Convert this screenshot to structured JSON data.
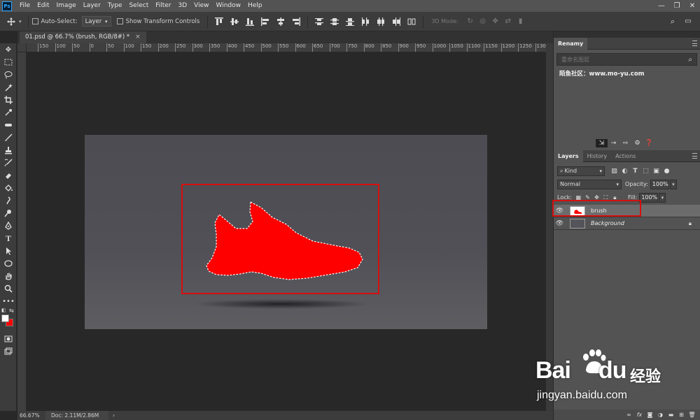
{
  "app": {
    "logo": "Ps"
  },
  "menu": [
    "File",
    "Edit",
    "Image",
    "Layer",
    "Type",
    "Select",
    "Filter",
    "3D",
    "View",
    "Window",
    "Help"
  ],
  "options": {
    "auto_select_label": "Auto-Select:",
    "auto_select_value": "Layer",
    "show_transform_label": "Show Transform Controls",
    "mode_3d_label": "3D Mode:"
  },
  "document": {
    "tab_title": "01.psd @ 66.7% (brush, RGB/8#) *",
    "close": "×"
  },
  "ruler": {
    "top_labels": [
      "150",
      "100",
      "50",
      "0",
      "50",
      "100",
      "150",
      "200",
      "250",
      "300",
      "350",
      "400",
      "450",
      "500",
      "550",
      "600",
      "650",
      "700",
      "750",
      "800",
      "850",
      "900",
      "950",
      "1000",
      "1050",
      "1100",
      "1150",
      "1200",
      "1250",
      "1300",
      "1350",
      "14"
    ]
  },
  "status": {
    "zoom": "66.67%",
    "doc": "Doc: 2.11M/2.86M",
    "arrow": "›"
  },
  "renamy": {
    "title": "Renamy",
    "placeholder": "重命名图层",
    "site": "陌鱼社区：www.mo-yu.com"
  },
  "layers_panel": {
    "tabs": [
      "Layers",
      "History",
      "Actions"
    ],
    "kind_label": "Kind",
    "blend_mode": "Normal",
    "opacity_label": "Opacity:",
    "opacity_value": "100%",
    "lock_label": "Lock:",
    "fill_label": "Fill:",
    "fill_value": "100%",
    "layers": [
      {
        "name": "brush",
        "selected": true
      },
      {
        "name": "Background",
        "locked": true
      }
    ]
  },
  "watermark": {
    "brand": "Bai",
    "brand2": "du",
    "cn": "经验",
    "url": "jingyan.baidu.com"
  },
  "colors": {
    "foreground": "#ffffff",
    "background": "#ff0000",
    "shoe_fill": "#ff0000",
    "highlight": "#d50f0f"
  }
}
